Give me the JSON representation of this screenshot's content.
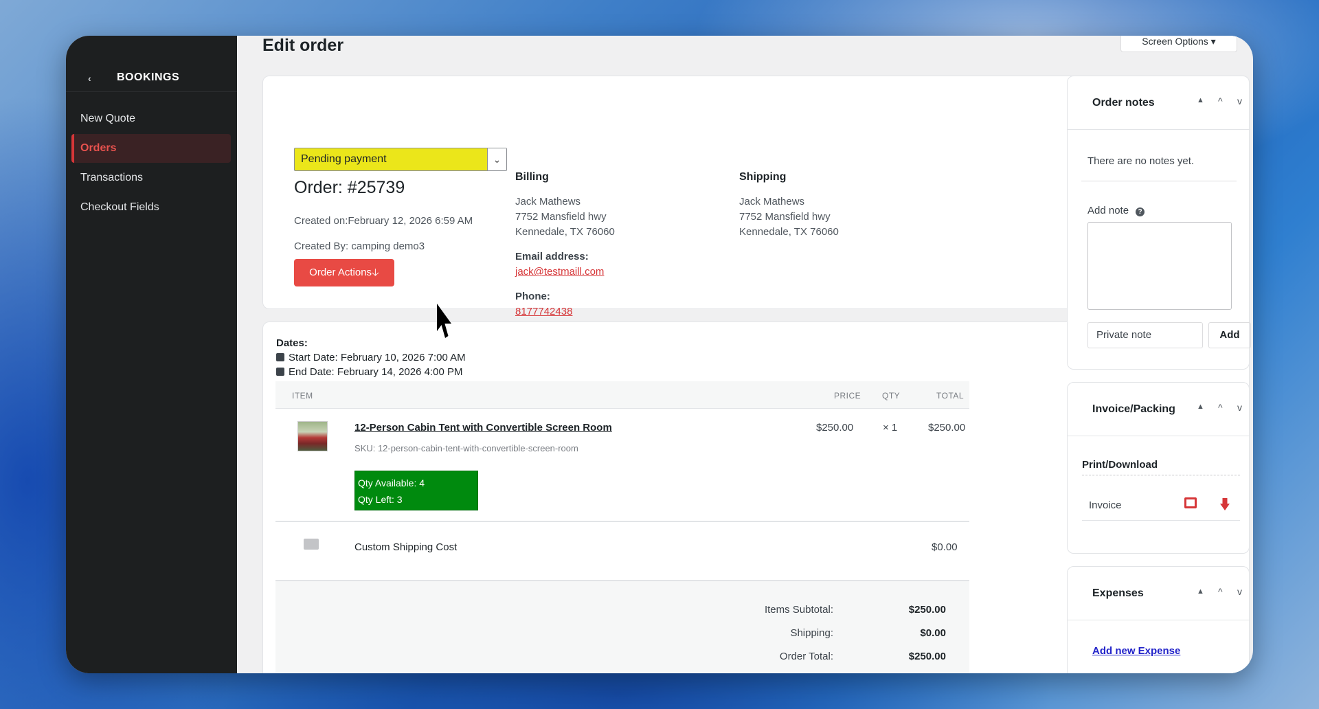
{
  "sidebar": {
    "title": "BOOKINGS",
    "items": [
      {
        "label": "New Quote"
      },
      {
        "label": "Orders"
      },
      {
        "label": "Transactions"
      },
      {
        "label": "Checkout Fields"
      }
    ]
  },
  "page": {
    "title": "Edit order",
    "screen_options": "Screen Options ▾"
  },
  "order": {
    "status": "Pending payment",
    "status_color": "#ebe61a",
    "number": "Order: #25739",
    "created_on": "Created on:February 12, 2026 6:59 AM",
    "created_by": "Created By: camping demo3",
    "actions_label": "Order Actions🡣"
  },
  "billing": {
    "heading": "Billing",
    "name": "Jack Mathews",
    "street": "7752 Mansfield hwy",
    "city": "Kennedale, TX 76060",
    "email_label": "Email address:",
    "email": "jack@testmaill.com",
    "phone_label": "Phone:",
    "phone": "8177742438"
  },
  "shipping": {
    "heading": "Shipping",
    "name": "Jack Mathews",
    "street": "7752 Mansfield hwy",
    "city": "Kennedale, TX 76060"
  },
  "dates": {
    "heading": "Dates:",
    "start": "Start Date: February 10, 2026 7:00 AM",
    "end": "End Date: February 14, 2026 4:00 PM"
  },
  "table": {
    "headers": {
      "item": "ITEM",
      "price": "PRICE",
      "qty": "QTY",
      "total": "TOTAL"
    },
    "item": {
      "name": "12-Person Cabin Tent with Convertible Screen Room",
      "sku": "SKU: 12-person-cabin-tent-with-convertible-screen-room",
      "price": "$250.00",
      "qty": "× 1",
      "total": "$250.00",
      "qty_available": "Qty Available: 4",
      "qty_left": "Qty Left: 3"
    },
    "shipping_row": {
      "label": "Custom Shipping Cost",
      "total": "$0.00"
    }
  },
  "totals": {
    "subtotal_label": "Items Subtotal:",
    "subtotal": "$250.00",
    "shipping_label": "Shipping:",
    "shipping": "$0.00",
    "order_total_label": "Order Total:",
    "order_total": "$250.00"
  },
  "notes_panel": {
    "title": "Order notes",
    "empty": "There are no notes yet.",
    "add_label": "Add note",
    "note_type": "Private note",
    "add_button": "Add"
  },
  "invoice_panel": {
    "title": "Invoice/Packing",
    "print_label": "Print/Download",
    "invoice_label": "Invoice"
  },
  "expenses_panel": {
    "title": "Expenses",
    "add_link": "Add new Expense"
  },
  "icons": {
    "panel_up": "^",
    "panel_down": "v",
    "panel_toggle": "▲"
  }
}
